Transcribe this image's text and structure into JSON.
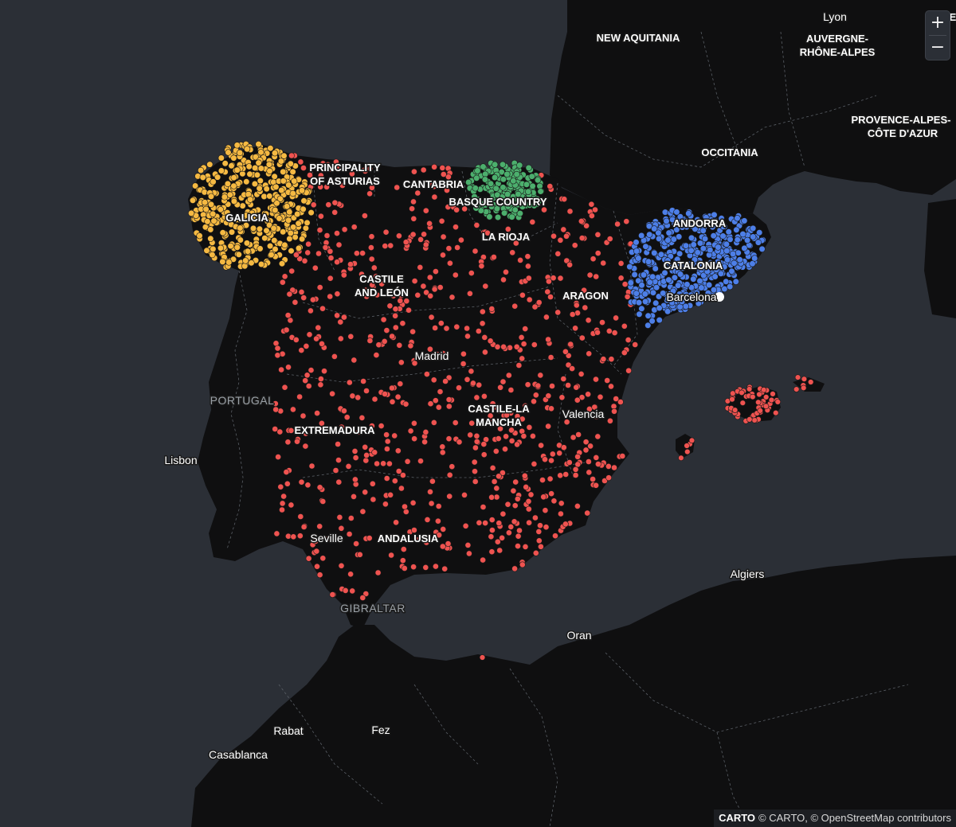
{
  "map": {
    "colors": {
      "sea": "#2b2f36",
      "land": "#0f0f10",
      "border": "#5a5f66",
      "red": "#ef5350",
      "yellow": "#f5b942",
      "green": "#4caf6d",
      "blue": "#4d7fe8",
      "marker": "#ffffff"
    },
    "labels": {
      "lyon": "Lyon",
      "le": "LE",
      "new_aquitania": "NEW AQUITANIA",
      "auvergne_1": "AUVERGNE-",
      "auvergne_2": "RHÔNE-ALPES",
      "provence_1": "PROVENCE-ALPES-",
      "provence_2": "CÔTE D'AZUR",
      "occitania": "OCCITANIA",
      "asturias_1": "PRINCIPALITY",
      "asturias_2": "OF ASTURIAS",
      "cantabria": "CANTABRIA",
      "basque": "BASQUE COUNTRY",
      "la_rioja": "LA RIOJA",
      "andorra": "ANDORRA",
      "catalonia": "CATALONIA",
      "barcelona": "Barcelona",
      "galicia": "GALICIA",
      "castile_1": "CASTILE",
      "castile_2": "AND LEÓN",
      "aragon": "ARAGON",
      "madrid": "Madrid",
      "portugal": "PORTUGAL",
      "castilla_1": "CASTILE-LA",
      "castilla_2": "MANCHA",
      "valencia": "Valencia",
      "extremadura": "EXTREMADURA",
      "lisbon": "Lisbon",
      "seville": "Seville",
      "andalusia": "ANDALUSIA",
      "gibraltar": "GIBRALTAR",
      "algiers": "Algiers",
      "oran": "Oran",
      "rabat": "Rabat",
      "fez": "Fez",
      "casablanca": "Casablanca"
    },
    "zoom": {
      "in": "+",
      "out": "−"
    },
    "attribution": {
      "logo": "CARTO",
      "text": "© CARTO, © OpenStreetMap contributors"
    }
  }
}
